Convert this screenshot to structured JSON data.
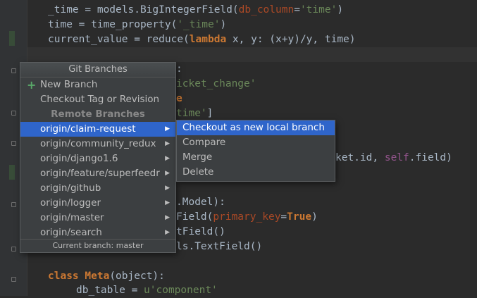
{
  "code": {
    "line1": {
      "a": "_time = models.BigIntegerField(",
      "b": "db_column",
      "c": "=",
      "d": "'time'",
      "e": ")"
    },
    "line2": {
      "a": "time = time_property(",
      "b": "'_time'",
      "c": ")"
    },
    "line3": {
      "a": "current_value = reduce(",
      "b": "lambda",
      "c": " x, y: (x+y)/y, time)"
    },
    "line5": {
      "a": ":"
    },
    "line6": {
      "a": "icket_change'"
    },
    "line7": {
      "a": "e"
    },
    "line8": {
      "a": "time'",
      "b": "]"
    },
    "line10": {
      "a": "ket.id, ",
      "b": "self",
      "c": ".field)"
    },
    "line13": {
      "a": ".Model):"
    },
    "line14": {
      "a": "Field(",
      "b": "primary_key",
      "c": "=",
      "d": "True",
      "e": ")"
    },
    "line15": {
      "a": "tField()"
    },
    "line16": {
      "a": "ls.TextField()"
    },
    "line18": {
      "a": "class",
      "b": " ",
      "c": "Meta",
      "d": "(object):"
    },
    "line19": {
      "a": "db_table = ",
      "b": "u'component'"
    }
  },
  "popup": {
    "title": "Git Branches",
    "new_branch": "New Branch",
    "checkout_tag": "Checkout Tag or Revision",
    "remote_header": "Remote Branches",
    "branches": [
      "origin/claim-request",
      "origin/community_redux",
      "origin/django1.6",
      "origin/feature/superfeedr",
      "origin/github",
      "origin/logger",
      "origin/master",
      "origin/search"
    ],
    "footer": "Current branch: master"
  },
  "submenu": {
    "items": [
      "Checkout as new local branch",
      "Compare",
      "Merge",
      "Delete"
    ]
  }
}
